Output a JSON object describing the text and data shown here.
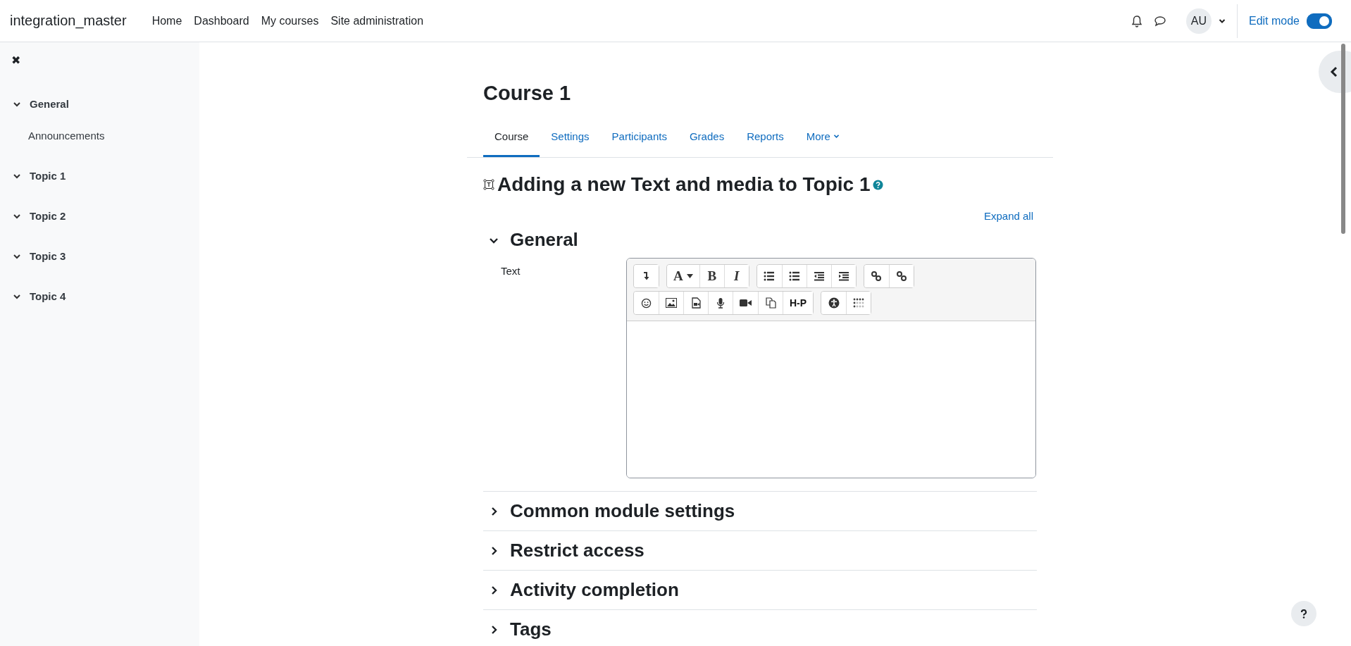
{
  "navbar": {
    "site_name": "integration_master",
    "links": [
      {
        "label": "Home"
      },
      {
        "label": "Dashboard"
      },
      {
        "label": "My courses"
      },
      {
        "label": "Site administration"
      }
    ],
    "avatar": "AU",
    "edit_mode": {
      "label": "Edit mode",
      "on": true
    }
  },
  "sidebar": {
    "close": "✖",
    "items": [
      {
        "label": "General",
        "expanded": true,
        "children": [
          {
            "label": "Announcements"
          }
        ]
      },
      {
        "label": "Topic 1",
        "expanded": true
      },
      {
        "label": "Topic 2",
        "expanded": true
      },
      {
        "label": "Topic 3",
        "expanded": true
      },
      {
        "label": "Topic 4",
        "expanded": true
      }
    ]
  },
  "course_title": "Course 1",
  "tabs": [
    {
      "label": "Course",
      "selected": true
    },
    {
      "label": "Settings",
      "selected": false
    },
    {
      "label": "Participants",
      "selected": false
    },
    {
      "label": "Grades",
      "selected": false
    },
    {
      "label": "Reports",
      "selected": false
    },
    {
      "label": "More",
      "selected": false
    }
  ],
  "page_heading": "Adding a new Text and media to Topic 1",
  "expand_all": "Expand all",
  "sections": [
    {
      "title": "General",
      "expanded": true
    },
    {
      "title": "Common module settings",
      "expanded": false
    },
    {
      "title": "Restrict access",
      "expanded": false
    },
    {
      "title": "Activity completion",
      "expanded": false
    },
    {
      "title": "Tags",
      "expanded": false
    }
  ],
  "text_field": {
    "label": "Text",
    "toolbar": [
      [
        [
          {
            "kind": "collapse"
          }
        ],
        [
          {
            "kind": "glyph",
            "glyph": "A",
            "dropdown": true
          },
          {
            "kind": "glyph",
            "glyph": "B"
          },
          {
            "kind": "glyph",
            "glyph": "I",
            "italic": true
          }
        ],
        [
          {
            "kind": "bullets"
          },
          {
            "kind": "numbers"
          },
          {
            "kind": "outdent"
          },
          {
            "kind": "indent"
          }
        ],
        [
          {
            "kind": "link"
          },
          {
            "kind": "unlink"
          }
        ]
      ],
      [
        [
          {
            "kind": "emoji"
          },
          {
            "kind": "image"
          },
          {
            "kind": "media"
          },
          {
            "kind": "mic"
          },
          {
            "kind": "video"
          },
          {
            "kind": "copy"
          },
          {
            "kind": "glyph",
            "glyph": "H-P"
          }
        ],
        [
          {
            "kind": "accessibility"
          },
          {
            "kind": "braille"
          }
        ]
      ]
    ]
  }
}
